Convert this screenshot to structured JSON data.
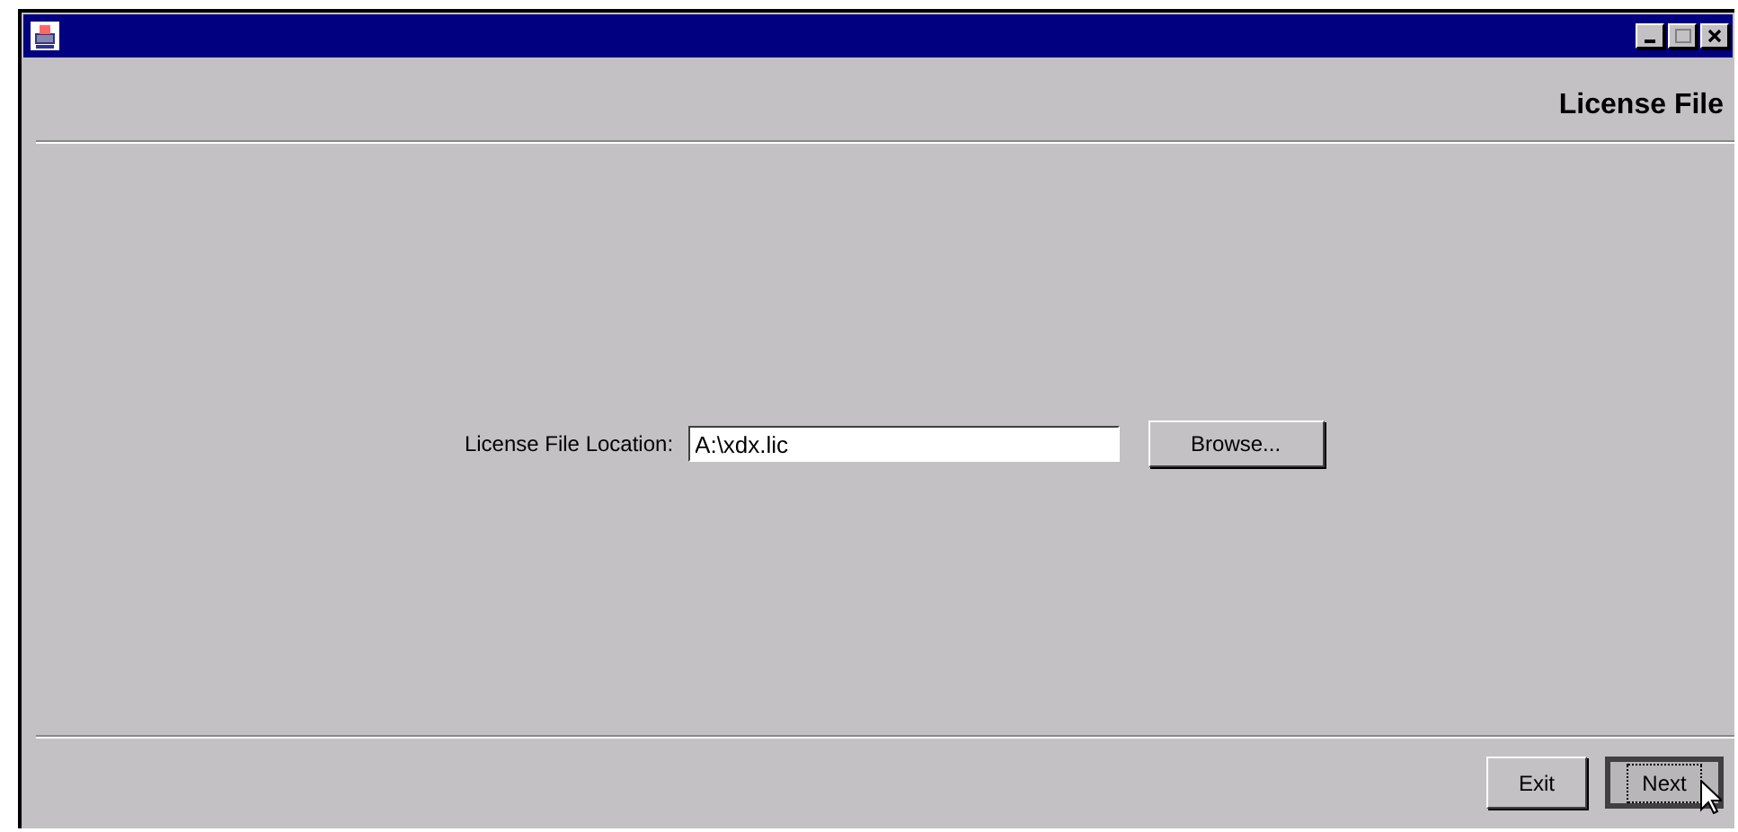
{
  "window": {
    "title_bar": {
      "controls": [
        {
          "kind": "minimize"
        },
        {
          "kind": "maximize"
        },
        {
          "kind": "close"
        }
      ]
    }
  },
  "header": {
    "title": "License File"
  },
  "form": {
    "label": "License File Location:",
    "value": "A:\\xdx.lic",
    "browse_button": "Browse..."
  },
  "buttons": [
    {
      "label": "Exit",
      "focused": false
    },
    {
      "label": "Next",
      "focused": true
    }
  ]
}
